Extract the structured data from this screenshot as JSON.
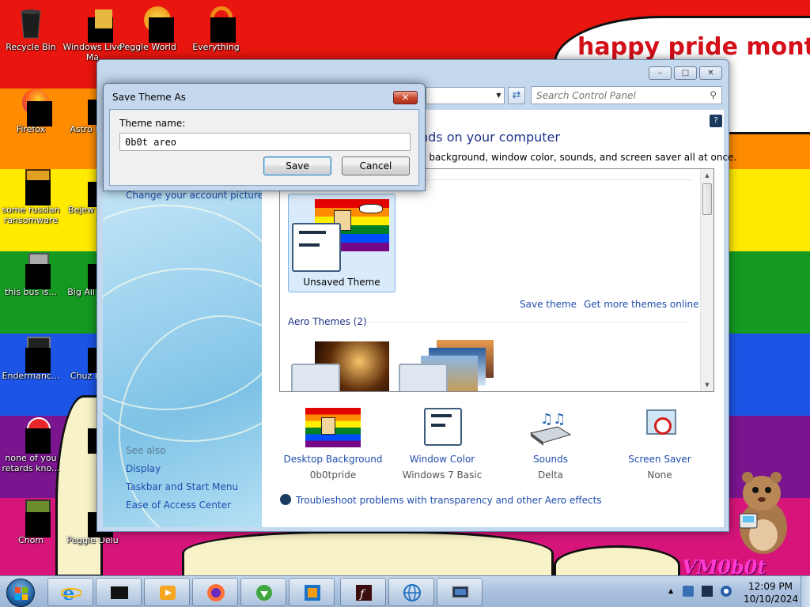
{
  "desktop": {
    "banner_text": "happy pride month",
    "watermark": "VM0b0t",
    "icons": [
      {
        "label": "Recycle Bin"
      },
      {
        "label": "Windows Live Ma"
      },
      {
        "label": "Peggle World"
      },
      {
        "label": "Everything"
      },
      {
        "label": "Firefox"
      },
      {
        "label": "Astro Delu"
      },
      {
        "label": "some russian ransomware"
      },
      {
        "label": "Bejew Delu"
      },
      {
        "label": "this bus is..."
      },
      {
        "label": "Big All Delu"
      },
      {
        "label": "Endermanc..."
      },
      {
        "label": "Chuz Delu"
      },
      {
        "label": "none of you retards kno..."
      },
      {
        "label": ""
      },
      {
        "label": "Chom"
      },
      {
        "label": "Peggle Delu"
      }
    ]
  },
  "window": {
    "search_placeholder": "Search Control Panel",
    "heading": "nds on your computer",
    "subheading": "p background, window color, sounds, and screen saver all at once.",
    "left_pane": {
      "change_account_picture": "Change your account picture",
      "see_also": "See also",
      "links": [
        "Display",
        "Taskbar and Start Menu",
        "Ease of Access Center"
      ]
    },
    "themes": {
      "unsaved_label": "Unsaved Theme",
      "save_theme": "Save theme",
      "get_more": "Get more themes online",
      "aero_section": "Aero Themes (2)"
    },
    "bottom": [
      {
        "label": "Desktop Background",
        "value": "0b0tpride"
      },
      {
        "label": "Window Color",
        "value": "Windows 7 Basic"
      },
      {
        "label": "Sounds",
        "value": "Delta"
      },
      {
        "label": "Screen Saver",
        "value": "None"
      }
    ],
    "troubleshoot": "Troubleshoot problems with transparency and other Aero effects"
  },
  "dialog": {
    "title": "Save Theme As",
    "label": "Theme name:",
    "input_value": "0b0t areo",
    "save": "Save",
    "cancel": "Cancel"
  },
  "taskbar": {
    "time": "12:09 PM",
    "date": "10/10/2024"
  },
  "colors": {
    "link": "#1f4cad",
    "heading": "#1e3287",
    "banner": "#d4101a"
  }
}
